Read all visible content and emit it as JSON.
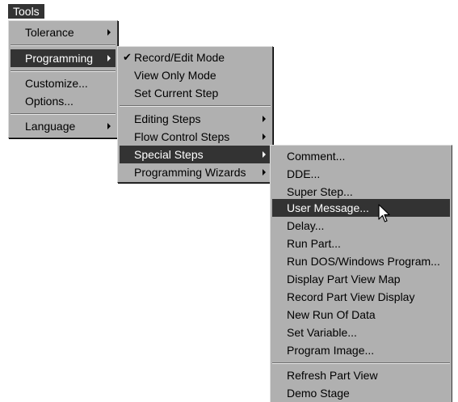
{
  "menubar": {
    "tools_label": "Tools"
  },
  "tools_menu": {
    "items": [
      {
        "label": "Tolerance"
      },
      {
        "label": "Programming"
      },
      {
        "label": "Customize..."
      },
      {
        "label": "Options..."
      },
      {
        "label": "Language"
      }
    ]
  },
  "programming_menu": {
    "items": [
      {
        "label": "Record/Edit Mode",
        "checked": true
      },
      {
        "label": "View Only Mode"
      },
      {
        "label": "Set Current Step"
      },
      {
        "label": "Editing Steps"
      },
      {
        "label": "Flow Control Steps"
      },
      {
        "label": "Special Steps"
      },
      {
        "label": "Programming Wizards"
      }
    ]
  },
  "special_steps_menu": {
    "items": [
      {
        "label": "Comment..."
      },
      {
        "label": "DDE..."
      },
      {
        "label": "Super Step..."
      },
      {
        "label": "User Message..."
      },
      {
        "label": "Delay..."
      },
      {
        "label": "Run Part..."
      },
      {
        "label": "Run DOS/Windows Program..."
      },
      {
        "label": "Display Part View Map"
      },
      {
        "label": "Record Part View Display"
      },
      {
        "label": "New Run Of Data"
      },
      {
        "label": "Set Variable..."
      },
      {
        "label": "Program Image..."
      },
      {
        "label": "Refresh Part View"
      },
      {
        "label": "Demo Stage"
      }
    ]
  },
  "colors": {
    "menu_bg": "#b0b0b0",
    "highlight": "#333333",
    "highlight_text": "#ffffff"
  },
  "icons": {
    "checkmark": "check-icon",
    "submenu": "submenu-arrow-icon",
    "pointer": "mouse-pointer-icon"
  }
}
